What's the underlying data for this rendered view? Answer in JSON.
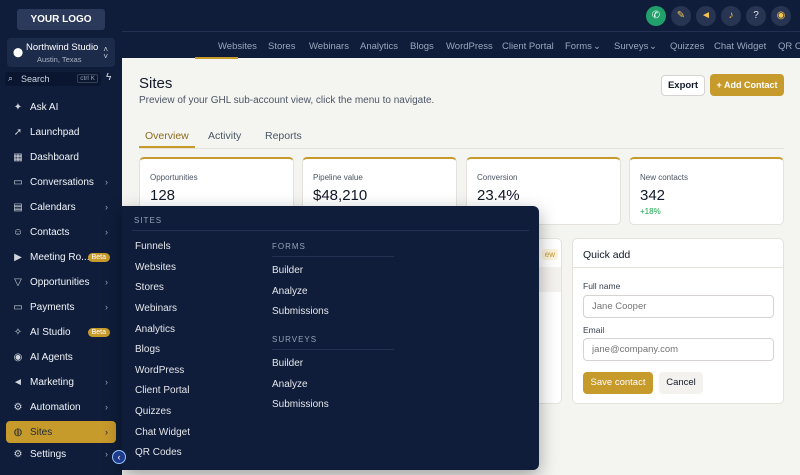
{
  "sidebar": {
    "logo": "YOUR LOGO",
    "account": {
      "name": "Northwind Studio",
      "location": "Austin, Texas"
    },
    "search": {
      "placeholder": "Search",
      "shortcut": "ctrl K"
    },
    "items": [
      {
        "label": "Ask AI",
        "icon": "sparkle-icon"
      },
      {
        "label": "Launchpad",
        "icon": "rocket-icon"
      },
      {
        "label": "Dashboard",
        "icon": "grid-icon"
      },
      {
        "label": "Conversations",
        "icon": "chat-icon",
        "arrow": "›"
      },
      {
        "label": "Calendars",
        "icon": "calendar-icon",
        "arrow": "›"
      },
      {
        "label": "Contacts",
        "icon": "contacts-icon",
        "arrow": "›"
      },
      {
        "label": "Meeting Ro...",
        "icon": "video-icon",
        "badge": "Beta"
      },
      {
        "label": "Opportunities",
        "icon": "filter-icon",
        "arrow": "›"
      },
      {
        "label": "Payments",
        "icon": "card-icon",
        "arrow": "›"
      },
      {
        "label": "AI Studio",
        "icon": "ai-icon",
        "badge": "Beta"
      },
      {
        "label": "AI Agents",
        "icon": "robot-icon"
      },
      {
        "label": "Marketing",
        "icon": "megaphone-icon",
        "arrow": "›"
      },
      {
        "label": "Automation",
        "icon": "automation-icon",
        "arrow": "›"
      },
      {
        "label": "Sites",
        "icon": "globe-icon",
        "arrow": "›",
        "active": true
      },
      {
        "label": "Settings",
        "icon": "gear-icon",
        "arrow": "›"
      }
    ]
  },
  "topbar": {
    "tabs": [
      "Websites",
      "Stores",
      "Webinars",
      "Analytics",
      "Blogs",
      "WordPress",
      "Client Portal",
      "Forms",
      "Surveys",
      "Quizzes",
      "Chat Widget",
      "QR C"
    ],
    "dropdown_arrow": "⌄"
  },
  "page": {
    "title": "Sites",
    "subtitle": "Preview of your GHL sub-account view, click the menu to navigate.",
    "export_label": "Export",
    "add_contact_label": "+ Add Contact",
    "tabs": [
      "Overview",
      "Activity",
      "Reports"
    ]
  },
  "stats": [
    {
      "label": "Opportunities",
      "value": "128"
    },
    {
      "label": "Pipeline value",
      "value": "$48,210"
    },
    {
      "label": "Conversion",
      "value": "23.4%"
    },
    {
      "label": "New contacts",
      "value": "342",
      "delta": "+18%"
    }
  ],
  "left_panel": {
    "tag": "ew"
  },
  "quick_add": {
    "title": "Quick add",
    "full_name_label": "Full name",
    "full_name_placeholder": "Jane Cooper",
    "email_label": "Email",
    "email_placeholder": "jane@company.com",
    "save_label": "Save contact",
    "cancel_label": "Cancel"
  },
  "flyout": {
    "sites_title": "SITES",
    "sites_items": [
      "Funnels",
      "Websites",
      "Stores",
      "Webinars",
      "Analytics",
      "Blogs",
      "WordPress",
      "Client Portal",
      "Quizzes",
      "Chat Widget",
      "QR Codes"
    ],
    "forms_title": "FORMS",
    "forms_items": [
      "Builder",
      "Analyze",
      "Submissions"
    ],
    "surveys_title": "SURVEYS",
    "surveys_items": [
      "Builder",
      "Analyze",
      "Submissions"
    ]
  },
  "colors": {
    "navy": "#0f1d3a",
    "gold": "#c79a2c",
    "green": "#22a06b"
  }
}
